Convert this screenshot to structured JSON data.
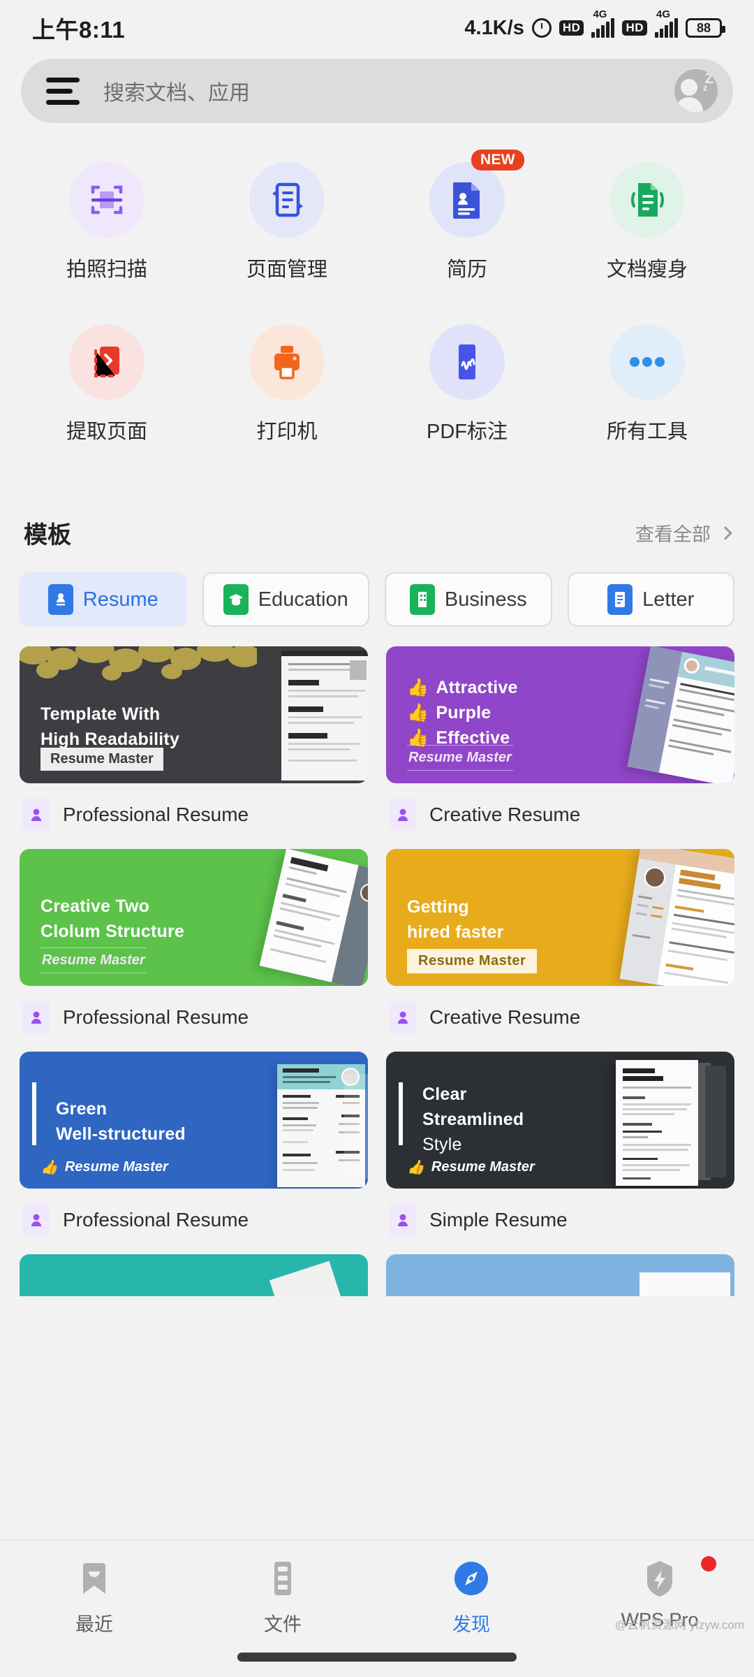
{
  "status_bar": {
    "time": "上午8:11",
    "net_speed": "4.1K/s",
    "hd_label_1": "HD",
    "hd_label_2": "HD",
    "net_gen_1": "4G",
    "net_gen_2": "4G",
    "battery": "88"
  },
  "search": {
    "placeholder": "搜索文档、应用"
  },
  "tools": {
    "row1": [
      {
        "label": "拍照扫描",
        "icon": "scan-icon",
        "color": "#8b5cf6",
        "bg": "#efe7fb",
        "badge": ""
      },
      {
        "label": "页面管理",
        "icon": "page-manage-icon",
        "color": "#3b53d8",
        "bg": "#e3e7f8",
        "badge": ""
      },
      {
        "label": "简历",
        "icon": "resume-icon",
        "color": "#3b53d8",
        "bg": "#dfe4f8",
        "badge": "NEW"
      },
      {
        "label": "文档瘦身",
        "icon": "doc-slim-icon",
        "color": "#17a75c",
        "bg": "#dff3e8",
        "badge": ""
      }
    ],
    "row2": [
      {
        "label": "提取页面",
        "icon": "extract-page-icon",
        "color": "#e8392b",
        "bg": "#fae2e1",
        "badge": ""
      },
      {
        "label": "打印机",
        "icon": "printer-icon",
        "color": "#f0661e",
        "bg": "#fbe6da",
        "badge": ""
      },
      {
        "label": "PDF标注",
        "icon": "pdf-annotate-icon",
        "color": "#4655e8",
        "bg": "#e0e2f9",
        "badge": ""
      },
      {
        "label": "所有工具",
        "icon": "more-dots-icon",
        "color": "#2f8fe8",
        "bg": "#e0eefa",
        "badge": ""
      }
    ]
  },
  "templates_section": {
    "title": "模板",
    "view_all": "查看全部"
  },
  "categories": [
    {
      "label": "Resume",
      "active": true,
      "icon": "resume-card-icon",
      "icon_color": "#2f7ae5"
    },
    {
      "label": "Education",
      "active": false,
      "icon": "graduation-icon",
      "icon_color": "#19b35c"
    },
    {
      "label": "Business",
      "active": false,
      "icon": "building-icon",
      "icon_color": "#19b35c"
    },
    {
      "label": "Letter",
      "active": false,
      "icon": "letter-icon",
      "icon_color": "#2f7ae5"
    }
  ],
  "template_cards": [
    {
      "lines": [
        "Template With",
        "High Readability"
      ],
      "badge": "Resume Master",
      "badge_style": "plain",
      "bg": "#3d3d42",
      "caption": "Professional Resume",
      "decor": "leaves"
    },
    {
      "lines": [
        "Attractive",
        "Purple",
        "Effective"
      ],
      "bullet": "👍",
      "badge": "Resume Master",
      "badge_style": "ital",
      "bg": "#9046c8",
      "caption": "Creative Resume",
      "decor": "doc-purple"
    },
    {
      "lines": [
        "Creative Two",
        "Clolum Structure"
      ],
      "badge": "Resume Master",
      "badge_style": "ital",
      "bg": "#5cc24a",
      "caption": "Professional Resume",
      "decor": "doc-palette"
    },
    {
      "lines": [
        "Getting",
        "hired faster"
      ],
      "badge": "Resume Master",
      "badge_style": "box",
      "bg": "#e7ab1c",
      "caption": "Creative Resume",
      "decor": "doc-james"
    },
    {
      "lines": [
        "Green",
        "Well-structured"
      ],
      "badge": "Resume Master",
      "badge_style": "thumbsup",
      "bg": "#2f66c2",
      "caption": "Professional Resume",
      "decor": "doc-palette-blue"
    },
    {
      "lines": [
        "Clear",
        "Streamlined",
        "Style"
      ],
      "badge": "Resume Master",
      "badge_style": "thumbsup",
      "bg": "#2c2f33",
      "caption": "Simple Resume",
      "decor": "doc-williams"
    }
  ],
  "partial_cards": [
    {
      "bg": "#27b6ab"
    },
    {
      "bg": "#7fb4e0"
    }
  ],
  "bottom_nav": [
    {
      "label": "最近",
      "icon": "recent-icon",
      "active": false,
      "dot": false
    },
    {
      "label": "文件",
      "icon": "files-icon",
      "active": false,
      "dot": false
    },
    {
      "label": "发现",
      "icon": "compass-icon",
      "active": true,
      "dot": false
    },
    {
      "label": "WPS Pro",
      "icon": "pro-lightning-icon",
      "active": false,
      "dot": true
    }
  ],
  "watermark": "@云帆资源网 yfzyw.com"
}
